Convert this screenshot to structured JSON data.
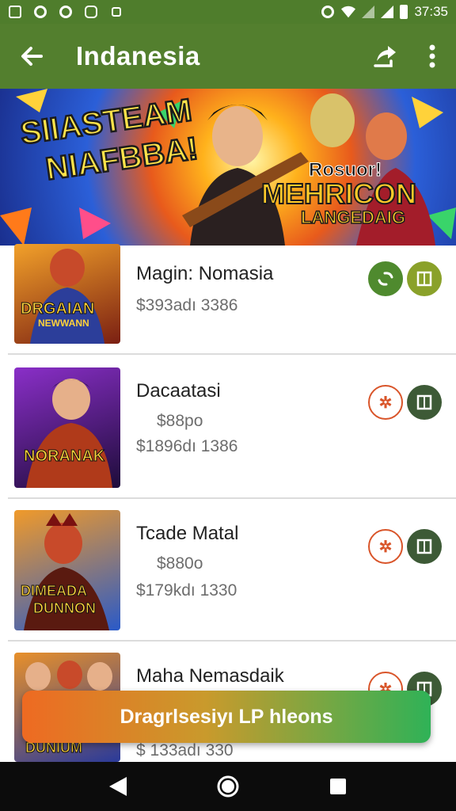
{
  "status_bar": {
    "time": "37:35",
    "notification_icons": [
      "image-icon",
      "circle-icon",
      "circle-icon",
      "app-icon",
      "lock-icon"
    ]
  },
  "app_bar": {
    "title": "Indanesia",
    "back_icon": "arrow-left-icon",
    "actions": [
      "share-icon",
      "more-vert-icon"
    ]
  },
  "banner": {
    "left_text_line1": "SIIASTEAM",
    "left_text_line2": "NIAFBBA!",
    "right_text_line1": "Rosuor!",
    "right_text_line2": "MEHRICON",
    "right_text_line3": "LANGEDAIG"
  },
  "items": [
    {
      "title": "Magin: Nomasia",
      "subtitle": "",
      "price": "$393adı 3386",
      "thumb_text_1": "DRGAIAN",
      "thumb_text_2": "NEWWANN",
      "thumb_bg_from": "#f2a12a",
      "thumb_bg_to": "#7a1f12",
      "btn1_style": "filled-green",
      "btn2_style": "filled-olive"
    },
    {
      "title": "Dacaatasi",
      "subtitle": "$88po",
      "price": "$1896dı 1386",
      "thumb_text_1": "NORANAK",
      "thumb_text_2": "",
      "thumb_bg_from": "#8a2fc8",
      "thumb_bg_to": "#1e0c3a",
      "btn1_style": "outline-orange",
      "btn2_style": "filled-darkgreen"
    },
    {
      "title": "Tcade Matal",
      "subtitle": "$880o",
      "price": "$179kdı 1330",
      "thumb_text_1": "DIMEADA",
      "thumb_text_2": "DUNNON",
      "thumb_bg_from": "#f09a2a",
      "thumb_bg_to": "#2a5ac8",
      "btn1_style": "outline-orange",
      "btn2_style": "filled-darkgreen"
    },
    {
      "title": "Maha Nemasdaik",
      "subtitle": "",
      "price": "$ 133adı 330",
      "thumb_text_1": "DUNIUM",
      "thumb_text_2": "",
      "thumb_bg_from": "#e8902a",
      "thumb_bg_to": "#2a3a9a",
      "btn1_style": "outline-orange",
      "btn2_style": "filled-darkgreen"
    }
  ],
  "cta": {
    "label": "Dragrlsesiyı LP hleons"
  },
  "nav_bar": [
    "back-triangle-icon",
    "home-circle-icon",
    "recents-square-icon"
  ],
  "colors": {
    "app_bar": "#537f2e",
    "green_button": "#4f8a2e",
    "olive_button": "#8aa12a",
    "dark_green_button": "#3d5a36",
    "orange_outline": "#d9552a"
  }
}
